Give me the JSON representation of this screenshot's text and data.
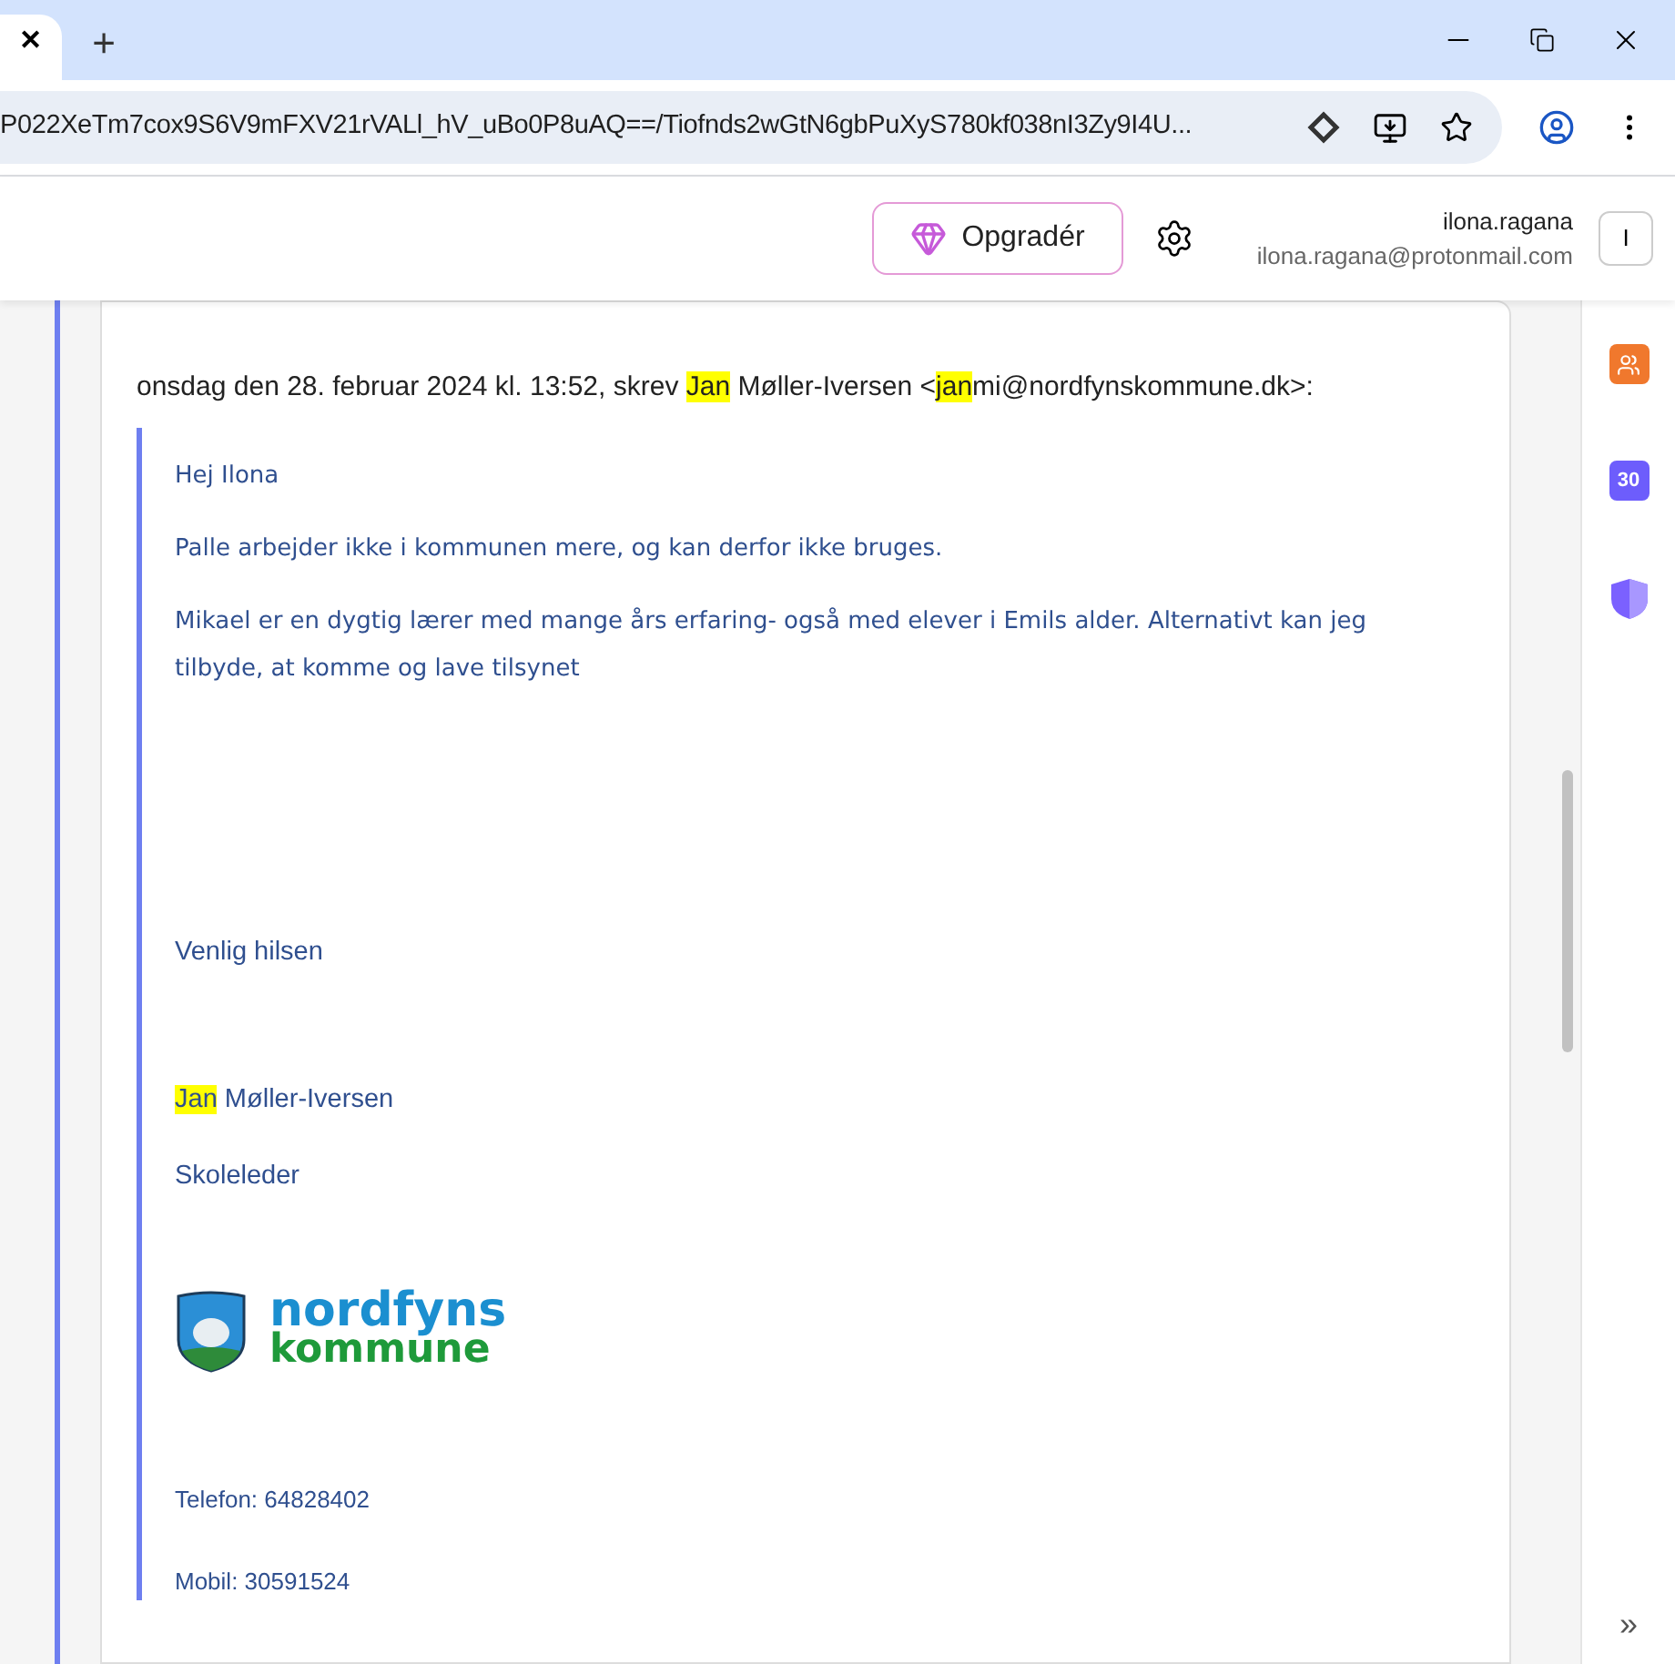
{
  "browser": {
    "tab_close": "✕",
    "new_tab": "+",
    "url": "P022XeTm7cox9S6V9mFXV21rVALl_hV_uBo0P8uAQ==/Tiofnds2wGtN6gbPuXyS780kf038nI3Zy9I4U..."
  },
  "header": {
    "upgrade_button": "Opgradér",
    "user_name": "ilona.ragana",
    "user_email": "ilona.ragana@protonmail.com",
    "avatar_initial": "I"
  },
  "message": {
    "quote_header": [
      {
        "text": "onsdag den 28. februar 2024 kl. 13:52, skrev ",
        "highlight": false
      },
      {
        "text": "Jan",
        "highlight": true
      },
      {
        "text": " Møller-Iversen <",
        "highlight": false
      },
      {
        "text": "jan",
        "highlight": true
      },
      {
        "text": "mi@nordfynskommune.dk>:",
        "highlight": false
      }
    ],
    "quote": [
      {
        "kind": "body",
        "parts": [
          {
            "text": "Hej Ilona",
            "highlight": false
          }
        ]
      },
      {
        "kind": "body",
        "parts": [
          {
            "text": "Palle arbejder ikke i kommunen mere, og kan derfor ikke bruges.",
            "highlight": false
          }
        ]
      },
      {
        "kind": "body",
        "parts": [
          {
            "text": "Mikael er en dygtig lærer med mange års erfaring- også med elever i Emils alder. Alternativt kan jeg tilbyde, at komme og lave tilsynet",
            "highlight": false
          }
        ]
      },
      {
        "kind": "closing",
        "parts": [
          {
            "text": "Venlig hilsen",
            "highlight": false
          }
        ]
      },
      {
        "kind": "name",
        "parts": [
          {
            "text": "Jan",
            "highlight": true
          },
          {
            "text": " Møller-Iversen",
            "highlight": false
          }
        ]
      },
      {
        "kind": "line",
        "parts": [
          {
            "text": "Skoleleder",
            "highlight": false
          }
        ]
      },
      {
        "kind": "logo",
        "lines": [
          "nordfyns",
          "kommune"
        ]
      },
      {
        "kind": "small",
        "parts": [
          {
            "text": "Telefon: 64828402",
            "highlight": false
          }
        ]
      },
      {
        "kind": "small",
        "parts": [
          {
            "text": "Mobil: 30591524",
            "highlight": false
          }
        ]
      }
    ]
  },
  "side_apps": [
    {
      "kind": "contacts"
    },
    {
      "kind": "calendar",
      "label": "30"
    },
    {
      "kind": "vpn"
    }
  ],
  "rail_toggle": "»"
}
